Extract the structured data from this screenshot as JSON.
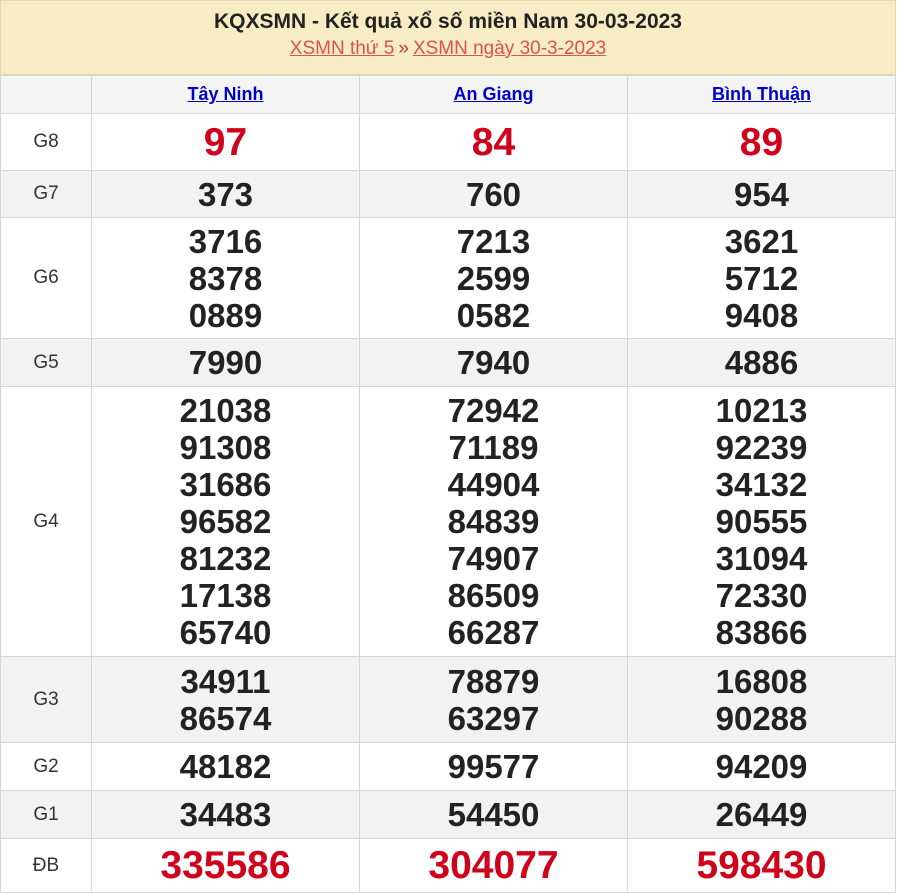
{
  "header": {
    "title": "KQXSMN - Kết quả xổ số miền Nam 30-03-2023",
    "crumb1": "XSMN thứ 5",
    "separator": "»",
    "crumb2": "XSMN ngày 30-3-2023"
  },
  "provinces": [
    "Tây Ninh",
    "An Giang",
    "Bình Thuận"
  ],
  "prizes": [
    {
      "label": "G8",
      "results": [
        [
          "97"
        ],
        [
          "84"
        ],
        [
          "89"
        ]
      ]
    },
    {
      "label": "G7",
      "results": [
        [
          "373"
        ],
        [
          "760"
        ],
        [
          "954"
        ]
      ]
    },
    {
      "label": "G6",
      "results": [
        [
          "3716",
          "8378",
          "0889"
        ],
        [
          "7213",
          "2599",
          "0582"
        ],
        [
          "3621",
          "5712",
          "9408"
        ]
      ]
    },
    {
      "label": "G5",
      "results": [
        [
          "7990"
        ],
        [
          "7940"
        ],
        [
          "4886"
        ]
      ]
    },
    {
      "label": "G4",
      "results": [
        [
          "21038",
          "91308",
          "31686",
          "96582",
          "81232",
          "17138",
          "65740"
        ],
        [
          "72942",
          "71189",
          "44904",
          "84839",
          "74907",
          "86509",
          "66287"
        ],
        [
          "10213",
          "92239",
          "34132",
          "90555",
          "31094",
          "72330",
          "83866"
        ]
      ]
    },
    {
      "label": "G3",
      "results": [
        [
          "34911",
          "86574"
        ],
        [
          "78879",
          "63297"
        ],
        [
          "16808",
          "90288"
        ]
      ]
    },
    {
      "label": "G2",
      "results": [
        [
          "48182"
        ],
        [
          "99577"
        ],
        [
          "94209"
        ]
      ]
    },
    {
      "label": "G1",
      "results": [
        [
          "34483"
        ],
        [
          "54450"
        ],
        [
          "26449"
        ]
      ]
    },
    {
      "label": "ĐB",
      "results": [
        [
          "335586"
        ],
        [
          "304077"
        ],
        [
          "598430"
        ]
      ]
    }
  ],
  "colors": {
    "header_bg": "#f8ecc4",
    "red": "#d0021b",
    "link": "#0000cc"
  }
}
